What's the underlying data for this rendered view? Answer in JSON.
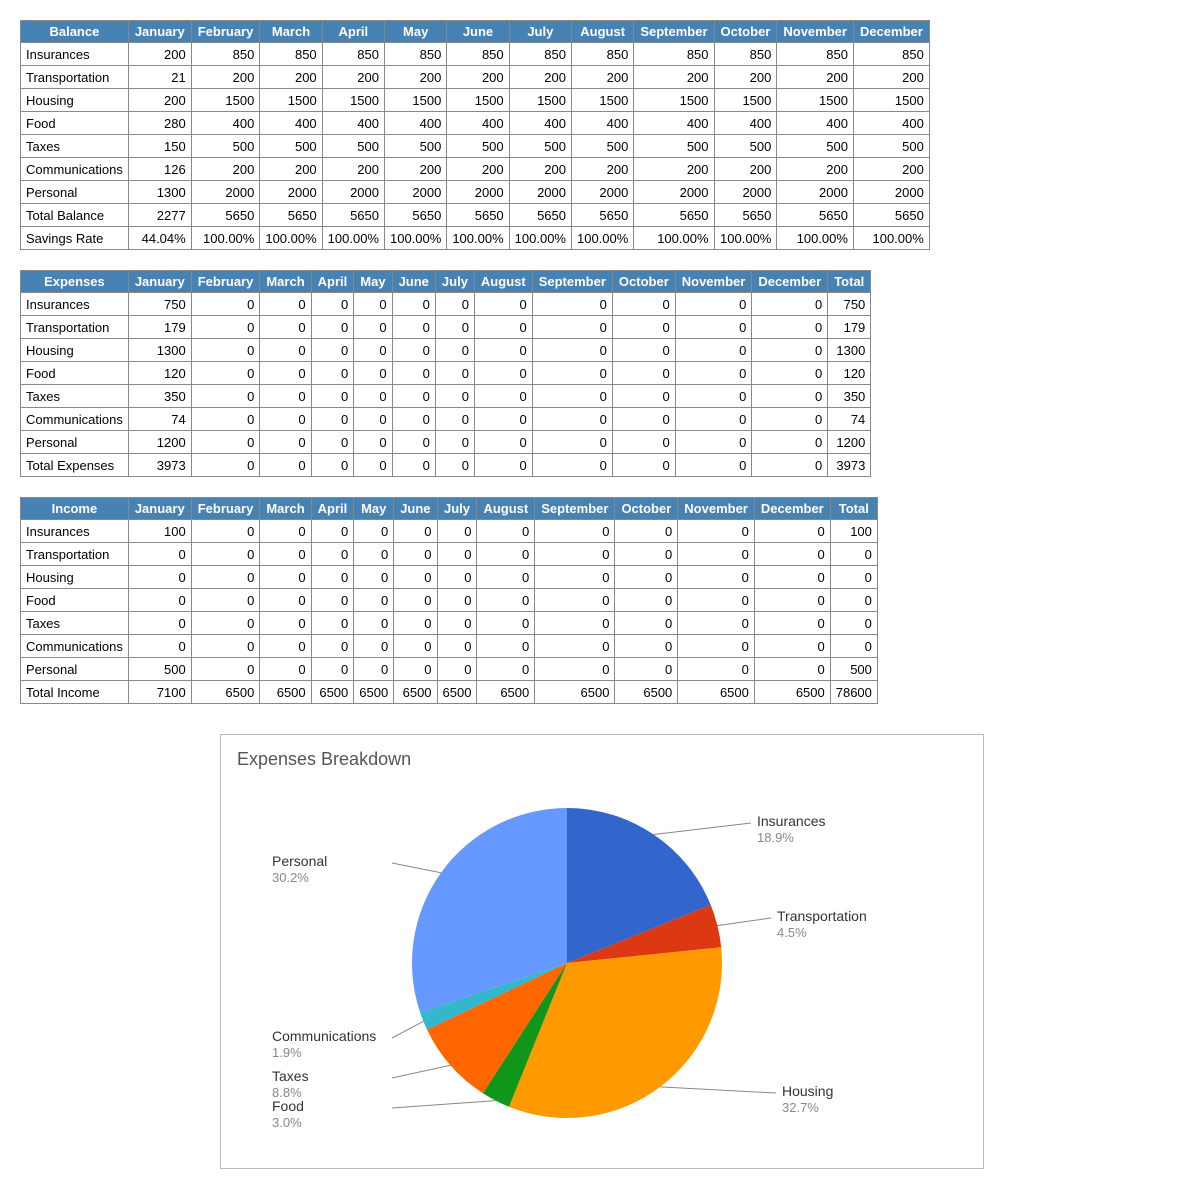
{
  "months": [
    "January",
    "February",
    "March",
    "April",
    "May",
    "June",
    "July",
    "August",
    "September",
    "October",
    "November",
    "December"
  ],
  "categories": [
    "Insurances",
    "Transportation",
    "Housing",
    "Food",
    "Taxes",
    "Communications",
    "Personal"
  ],
  "balance": {
    "header": "Balance",
    "rows": [
      {
        "label": "Insurances",
        "values": [
          200,
          850,
          850,
          850,
          850,
          850,
          850,
          850,
          850,
          850,
          850,
          850
        ]
      },
      {
        "label": "Transportation",
        "values": [
          21,
          200,
          200,
          200,
          200,
          200,
          200,
          200,
          200,
          200,
          200,
          200
        ]
      },
      {
        "label": "Housing",
        "values": [
          200,
          1500,
          1500,
          1500,
          1500,
          1500,
          1500,
          1500,
          1500,
          1500,
          1500,
          1500
        ]
      },
      {
        "label": "Food",
        "values": [
          280,
          400,
          400,
          400,
          400,
          400,
          400,
          400,
          400,
          400,
          400,
          400
        ]
      },
      {
        "label": "Taxes",
        "values": [
          150,
          500,
          500,
          500,
          500,
          500,
          500,
          500,
          500,
          500,
          500,
          500
        ]
      },
      {
        "label": "Communications",
        "values": [
          126,
          200,
          200,
          200,
          200,
          200,
          200,
          200,
          200,
          200,
          200,
          200
        ]
      },
      {
        "label": "Personal",
        "values": [
          1300,
          2000,
          2000,
          2000,
          2000,
          2000,
          2000,
          2000,
          2000,
          2000,
          2000,
          2000
        ]
      }
    ],
    "total": {
      "label": "Total Balance",
      "values": [
        2277,
        5650,
        5650,
        5650,
        5650,
        5650,
        5650,
        5650,
        5650,
        5650,
        5650,
        5650
      ]
    },
    "savings": {
      "label": "Savings Rate",
      "values": [
        "44.04%",
        "100.00%",
        "100.00%",
        "100.00%",
        "100.00%",
        "100.00%",
        "100.00%",
        "100.00%",
        "100.00%",
        "100.00%",
        "100.00%",
        "100.00%"
      ]
    }
  },
  "expenses": {
    "header": "Expenses",
    "rows": [
      {
        "label": "Insurances",
        "values": [
          750,
          0,
          0,
          0,
          0,
          0,
          0,
          0,
          0,
          0,
          0,
          0
        ],
        "total": 750
      },
      {
        "label": "Transportation",
        "values": [
          179,
          0,
          0,
          0,
          0,
          0,
          0,
          0,
          0,
          0,
          0,
          0
        ],
        "total": 179
      },
      {
        "label": "Housing",
        "values": [
          1300,
          0,
          0,
          0,
          0,
          0,
          0,
          0,
          0,
          0,
          0,
          0
        ],
        "total": 1300
      },
      {
        "label": "Food",
        "values": [
          120,
          0,
          0,
          0,
          0,
          0,
          0,
          0,
          0,
          0,
          0,
          0
        ],
        "total": 120
      },
      {
        "label": "Taxes",
        "values": [
          350,
          0,
          0,
          0,
          0,
          0,
          0,
          0,
          0,
          0,
          0,
          0
        ],
        "total": 350
      },
      {
        "label": "Communications",
        "values": [
          74,
          0,
          0,
          0,
          0,
          0,
          0,
          0,
          0,
          0,
          0,
          0
        ],
        "total": 74
      },
      {
        "label": "Personal",
        "values": [
          1200,
          0,
          0,
          0,
          0,
          0,
          0,
          0,
          0,
          0,
          0,
          0
        ],
        "total": 1200
      }
    ],
    "total": {
      "label": "Total Expenses",
      "values": [
        3973,
        0,
        0,
        0,
        0,
        0,
        0,
        0,
        0,
        0,
        0,
        0
      ],
      "total": 3973
    }
  },
  "income": {
    "header": "Income",
    "rows": [
      {
        "label": "Insurances",
        "values": [
          100,
          0,
          0,
          0,
          0,
          0,
          0,
          0,
          0,
          0,
          0,
          0
        ],
        "total": 100
      },
      {
        "label": "Transportation",
        "values": [
          0,
          0,
          0,
          0,
          0,
          0,
          0,
          0,
          0,
          0,
          0,
          0
        ],
        "total": 0
      },
      {
        "label": "Housing",
        "values": [
          0,
          0,
          0,
          0,
          0,
          0,
          0,
          0,
          0,
          0,
          0,
          0
        ],
        "total": 0
      },
      {
        "label": "Food",
        "values": [
          0,
          0,
          0,
          0,
          0,
          0,
          0,
          0,
          0,
          0,
          0,
          0
        ],
        "total": 0
      },
      {
        "label": "Taxes",
        "values": [
          0,
          0,
          0,
          0,
          0,
          0,
          0,
          0,
          0,
          0,
          0,
          0
        ],
        "total": 0
      },
      {
        "label": "Communications",
        "values": [
          0,
          0,
          0,
          0,
          0,
          0,
          0,
          0,
          0,
          0,
          0,
          0
        ],
        "total": 0
      },
      {
        "label": "Personal",
        "values": [
          500,
          0,
          0,
          0,
          0,
          0,
          0,
          0,
          0,
          0,
          0,
          0
        ],
        "total": 500
      }
    ],
    "total": {
      "label": "Total Income",
      "values": [
        7100,
        6500,
        6500,
        6500,
        6500,
        6500,
        6500,
        6500,
        6500,
        6500,
        6500,
        6500
      ],
      "total": 78600
    }
  },
  "totalHeader": "Total",
  "chart_data": {
    "type": "pie",
    "title": "Expenses Breakdown",
    "slices": [
      {
        "label": "Insurances",
        "value": 750,
        "pct": "18.9%",
        "color": "#3366cc"
      },
      {
        "label": "Transportation",
        "value": 179,
        "pct": "4.5%",
        "color": "#dc3912"
      },
      {
        "label": "Housing",
        "value": 1300,
        "pct": "32.7%",
        "color": "#ff9900"
      },
      {
        "label": "Food",
        "value": 120,
        "pct": "3.0%",
        "color": "#109618"
      },
      {
        "label": "Taxes",
        "value": 350,
        "pct": "8.8%",
        "color": "#ff6600"
      },
      {
        "label": "Communications",
        "value": 74,
        "pct": "1.9%",
        "color": "#33b7cc"
      },
      {
        "label": "Personal",
        "value": 1200,
        "pct": "30.2%",
        "color": "#6699ff"
      }
    ]
  }
}
